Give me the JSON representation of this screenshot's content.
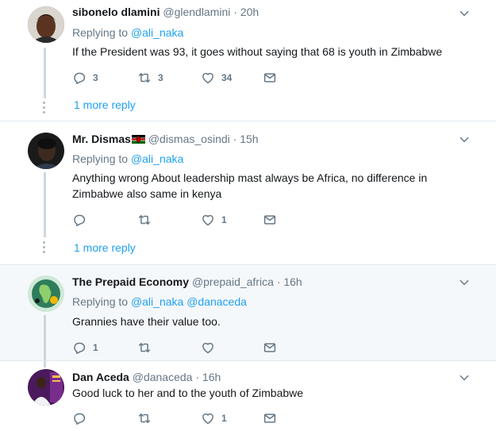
{
  "replies": [
    {
      "name": "sibonelo dlamini",
      "handle": "@glendlamini",
      "time": "20h",
      "replying_to_label": "Replying to",
      "mentions": [
        "@ali_naka"
      ],
      "text": "If the  President was 93, it goes without saying that 68 is youth in Zimbabwe",
      "reply_count": "3",
      "retweet_count": "3",
      "like_count": "34",
      "more_replies": "1 more reply"
    },
    {
      "name": "Mr. Dismas",
      "handle": "@dismas_osindi",
      "time": "15h",
      "replying_to_label": "Replying to",
      "mentions": [
        "@ali_naka"
      ],
      "text": "Anything wrong About leadership mast always be Africa, no difference in Zimbabwe also same in kenya",
      "reply_count": "",
      "retweet_count": "",
      "like_count": "1",
      "more_replies": "1 more reply"
    },
    {
      "name": "The Prepaid Economy",
      "handle": "@prepaid_africa",
      "time": "16h",
      "replying_to_label": "Replying to",
      "mentions": [
        "@ali_naka",
        "@danaceda"
      ],
      "text": "Grannies have their value too.",
      "reply_count": "1",
      "retweet_count": "",
      "like_count": ""
    },
    {
      "name": "Dan Aceda",
      "handle": "@danaceda",
      "time": "16h",
      "text": "Good luck to her and to the youth of Zimbabwe",
      "reply_count": "",
      "retweet_count": "",
      "like_count": "1"
    }
  ],
  "separator": "·",
  "icons": {
    "reply": "reply-icon",
    "retweet": "retweet-icon",
    "like": "heart-icon",
    "dm": "envelope-icon",
    "menu": "chevron-down-icon",
    "flag": "kenya-flag-icon"
  },
  "colors": {
    "link": "#1da1f2",
    "muted": "#657786",
    "text": "#14171a",
    "highlight": "#f5f8fa"
  }
}
